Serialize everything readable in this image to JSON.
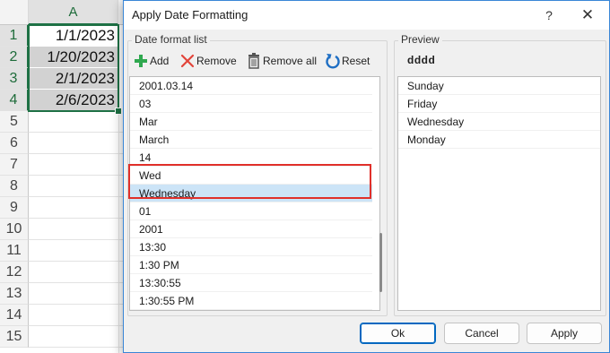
{
  "spreadsheet": {
    "column_headers": [
      "A"
    ],
    "row_numbers": [
      "1",
      "2",
      "3",
      "4",
      "5",
      "6",
      "7",
      "8",
      "9",
      "10",
      "11",
      "12",
      "13",
      "14",
      "15"
    ],
    "cells": [
      "1/1/2023",
      "1/20/2023",
      "2/1/2023",
      "2/6/2023"
    ]
  },
  "dialog": {
    "title": "Apply Date Formatting",
    "help": "?",
    "close": "✕",
    "format_list": {
      "label": "Date format list",
      "toolbar": {
        "add": "Add",
        "remove": "Remove",
        "remove_all": "Remove all",
        "reset": "Reset"
      },
      "items": [
        "2001.03.14",
        "03",
        "Mar",
        "March",
        "14",
        "Wed",
        "Wednesday",
        "01",
        "2001",
        "13:30",
        "1:30 PM",
        "13:30:55",
        "1:30:55 PM"
      ],
      "selected_item": "Wednesday"
    },
    "preview": {
      "label": "Preview",
      "format": "dddd",
      "items": [
        "Sunday",
        "Friday",
        "Wednesday",
        "Monday"
      ]
    },
    "buttons": {
      "ok": "Ok",
      "cancel": "Cancel",
      "apply": "Apply"
    }
  },
  "colors": {
    "excel_green": "#1e7145",
    "dialog_border": "#3a86d6",
    "selection": "#cce4f7",
    "highlight": "#e0302a"
  }
}
